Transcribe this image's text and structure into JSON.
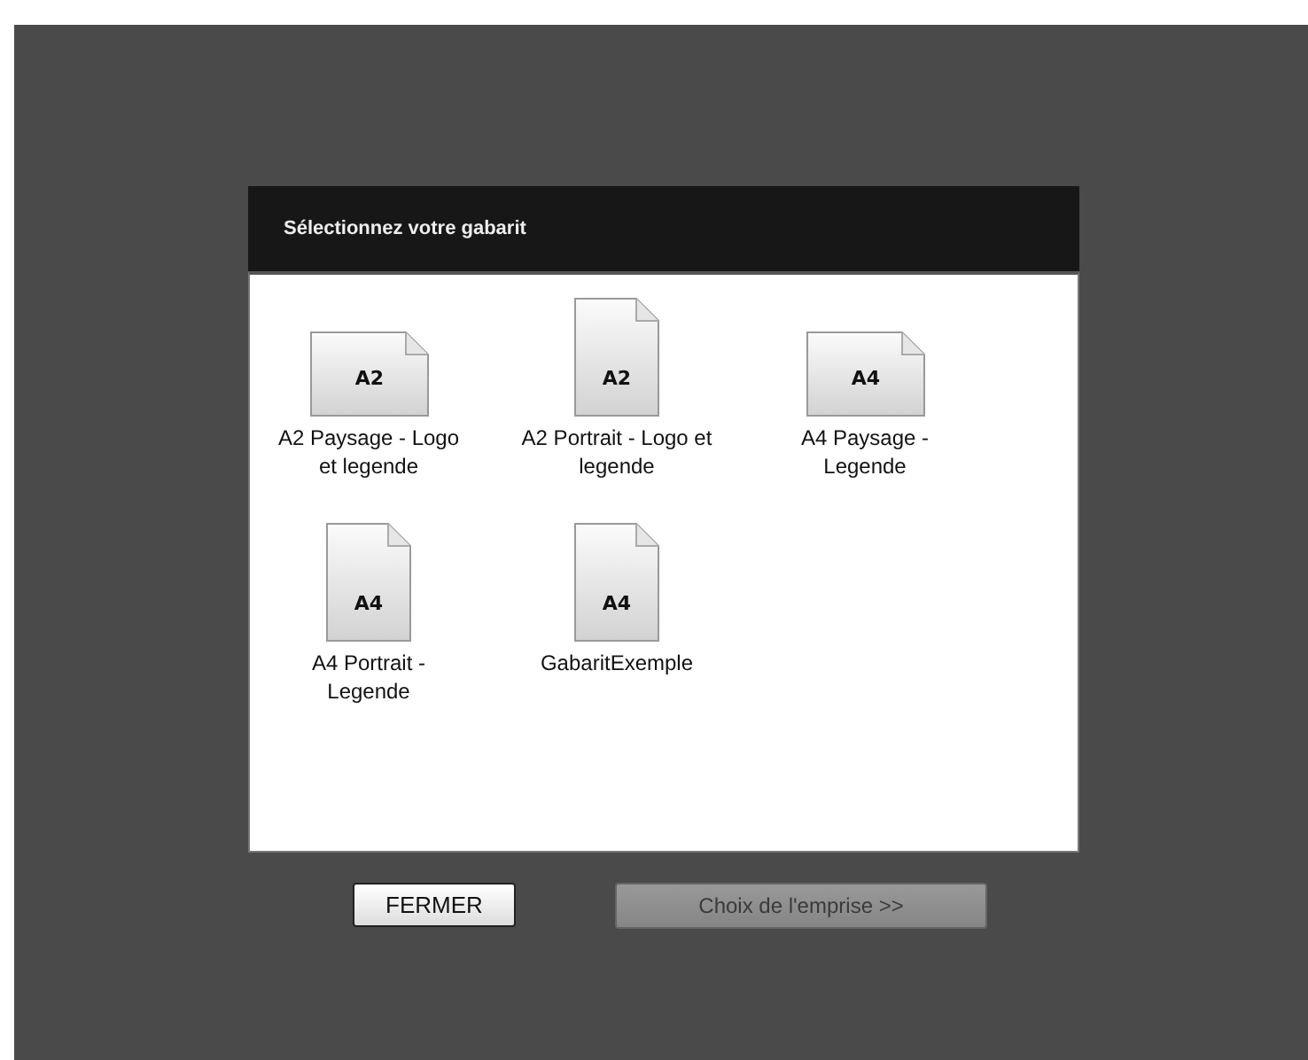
{
  "dialog": {
    "title": "Sélectionnez votre gabarit"
  },
  "templates": [
    {
      "format": "A2",
      "kind": "landscape",
      "label": "A2 Paysage - Logo et legende"
    },
    {
      "format": "A2",
      "kind": "portrait",
      "label": "A2 Portrait - Logo et legende"
    },
    {
      "format": "A4",
      "kind": "landscape",
      "label": "A4 Paysage - Legende"
    },
    {
      "format": "A4",
      "kind": "portrait",
      "label": "A4 Portrait - Legende"
    },
    {
      "format": "A4",
      "kind": "portrait",
      "label": "GabaritExemple"
    }
  ],
  "buttons": [
    {
      "label": "FERMER",
      "disabled": false
    },
    {
      "label": "Choix de l'emprise >>",
      "disabled": true
    }
  ]
}
